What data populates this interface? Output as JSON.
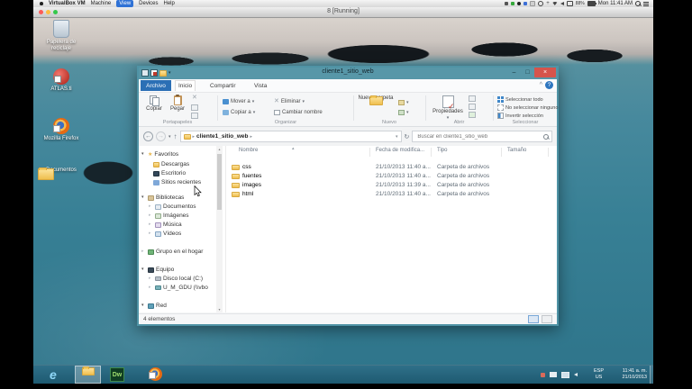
{
  "glyphs": {
    "expanded": "▾",
    "collapsed": "▸",
    "dropdown": "▾",
    "crumb": "▸",
    "back": "←",
    "forward": "→",
    "up": "↑",
    "refresh": "↻",
    "chevron_down": "▾",
    "minimize": "–",
    "maximize": "□",
    "close": "×",
    "help": "?",
    "ribbon_collapse": "^",
    "sort": "▴",
    "scroll_up": "▴",
    "scroll_down": "▾",
    "cut_x": "✕",
    "star": "★"
  },
  "mac": {
    "items": [
      "VirtualBox VM",
      "Machine",
      "View",
      "Devices",
      "Help"
    ],
    "battery": "88%",
    "clock": "Mon 11:41 AM"
  },
  "vm": {
    "title": "8 [Running]"
  },
  "desktop": {
    "icons": [
      "Papelera de reciclaje",
      "ATLAS.ti",
      "Mozilla Firefox",
      "Documentos"
    ]
  },
  "explorer": {
    "title": "cliente1_sitio_web",
    "tabs": [
      "Archivo",
      "Inicio",
      "Compartir",
      "Vista"
    ],
    "ribbon": {
      "portapapeles": {
        "label": "Portapapeles",
        "copiar": "Copiar",
        "pegar": "Pegar"
      },
      "organizar": {
        "label": "Organizar",
        "mover": "Mover a",
        "copiar_a": "Copiar a",
        "eliminar": "Eliminar",
        "cambiar": "Cambiar nombre"
      },
      "nuevo": {
        "label": "Nuevo",
        "nueva_carpeta": "Nueva carpeta"
      },
      "abrir": {
        "label": "Abrir",
        "propiedades": "Propiedades"
      },
      "seleccionar": {
        "label": "Seleccionar",
        "todo": "Seleccionar todo",
        "ninguno": "No seleccionar ninguno",
        "invertir": "Invertir selección"
      }
    },
    "address": {
      "path": "cliente1_sitio_web",
      "search_placeholder": "Buscar en cliente1_sitio_web"
    },
    "sidebar": {
      "favoritos": {
        "label": "Favoritos",
        "items": [
          "Descargas",
          "Escritorio",
          "Sitios recientes"
        ]
      },
      "bibliotecas": {
        "label": "Bibliotecas",
        "items": [
          "Documentos",
          "Imágenes",
          "Música",
          "Vídeos"
        ]
      },
      "grupo_hogar": {
        "label": "Grupo en el hogar"
      },
      "equipo": {
        "label": "Equipo",
        "items": [
          "Disco local (C:)",
          "U_M_GDU (\\\\vbo"
        ]
      },
      "red": {
        "label": "Red"
      }
    },
    "files": {
      "columns": [
        "Nombre",
        "Fecha de modifica...",
        "Tipo",
        "Tamaño"
      ],
      "rows": [
        {
          "name": "css",
          "date": "21/10/2013 11:40 a...",
          "type": "Carpeta de archivos",
          "size": ""
        },
        {
          "name": "fuentes",
          "date": "21/10/2013 11:40 a...",
          "type": "Carpeta de archivos",
          "size": ""
        },
        {
          "name": "images",
          "date": "21/10/2013 11:39 a...",
          "type": "Carpeta de archivos",
          "size": ""
        },
        {
          "name": "html",
          "date": "21/10/2013 11:40 a...",
          "type": "Carpeta de archivos",
          "size": ""
        }
      ]
    },
    "status": "4 elementos"
  },
  "taskbar": {
    "ie_glyph": "e",
    "dw_label": "Dw",
    "language_line1": "ESP",
    "language_line2": "US",
    "time": "11:41 a. m.",
    "date": "21/10/2013"
  },
  "colors": {
    "window_chrome": "#5797a8",
    "file_button_blue": "#2b6fb5",
    "taskbar_teal": "#25647b",
    "folder_yellow": "#f0c050"
  }
}
